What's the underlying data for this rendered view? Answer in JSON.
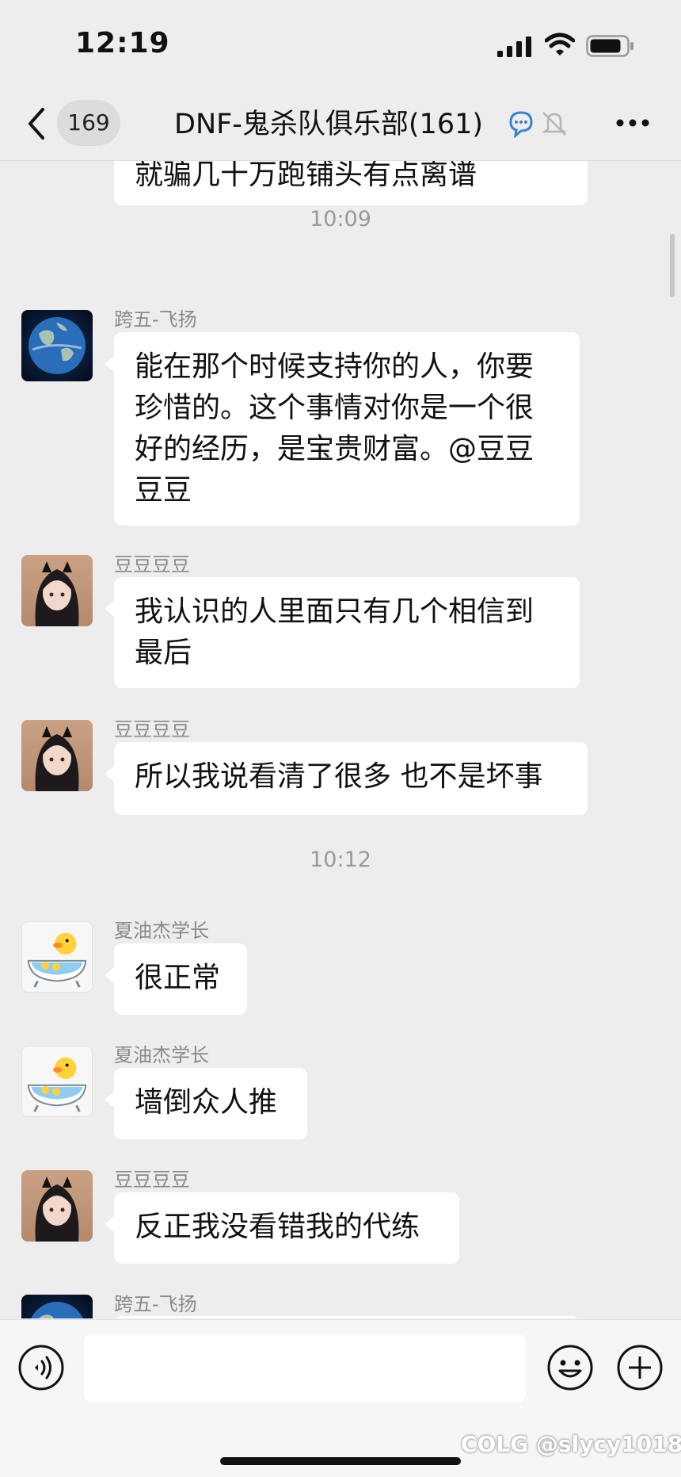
{
  "status": {
    "time": "12:19"
  },
  "header": {
    "unread_count": "169",
    "title": "DNF-鬼杀队俱乐部(161)"
  },
  "messages": [
    {
      "partial_text": "就骗几十万跑铺头有点离谱"
    },
    {
      "time": "10:09"
    },
    {
      "sender": "跨五-飞扬",
      "text": "能在那个时候支持你的人，你要珍惜的。这个事情对你是一个很好的经历，是宝贵财富。@豆豆豆豆",
      "avatar": "earth-avatar"
    },
    {
      "sender": "豆豆豆豆",
      "text": "我认识的人里面只有几个相信到最后",
      "avatar": "girl-avatar"
    },
    {
      "sender": "豆豆豆豆",
      "text": "所以我说看清了很多 也不是坏事",
      "avatar": "girl-avatar"
    },
    {
      "time": "10:12"
    },
    {
      "sender": "夏油杰学长",
      "text": "很正常",
      "avatar": "duck-avatar"
    },
    {
      "sender": "夏油杰学长",
      "text": "墙倒众人推",
      "avatar": "duck-avatar"
    },
    {
      "sender": "豆豆豆豆",
      "text": "反正我没看错我的代练",
      "avatar": "girl-avatar"
    },
    {
      "sender": "跨五-飞扬",
      "avatar": "earth-avatar"
    }
  ],
  "input": {
    "value": ""
  },
  "watermark": "COLG @slycy1018",
  "icons": [
    "back-icon",
    "signal-icon",
    "wifi-icon",
    "battery-icon",
    "chat-bubble-icon",
    "mute-bell-icon",
    "more-icon",
    "voice-icon",
    "emoji-icon",
    "plus-icon"
  ]
}
